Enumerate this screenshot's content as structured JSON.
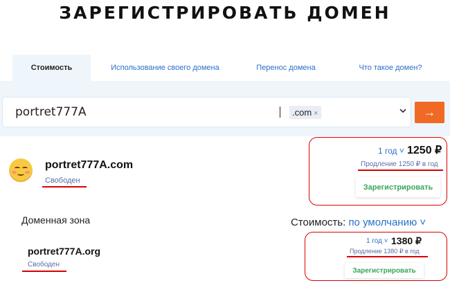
{
  "page": {
    "title": "ЗАРЕГИСТРИРОВАТЬ ДОМЕН"
  },
  "tabs": [
    {
      "label": "Стоимость",
      "active": true
    },
    {
      "label": "Использование своего домена",
      "active": false
    },
    {
      "label": "Перенос домена",
      "active": false
    },
    {
      "label": "Что такое домен?",
      "active": false
    }
  ],
  "search": {
    "value": "portret777A",
    "zone_chip": ".com",
    "chip_remove": "×",
    "dropdown_icon": "chevron-down-icon",
    "submit_icon": "arrow-right-icon",
    "submit_symbol": "→"
  },
  "results": [
    {
      "domain": "portret777A.com",
      "status": "Свободен",
      "period": "1 год ˅",
      "price": "1250 ₽",
      "renewal": "Продление 1250 ₽ в год",
      "register_label": "Зарегистрировать"
    },
    {
      "domain": "portret777A.org",
      "status": "Свободен",
      "period": "1 год ˅",
      "price": "1380 ₽",
      "renewal": "Продление 1380 ₽ в год",
      "register_label": "Зарегистрировать"
    }
  ],
  "zone_section": {
    "label": "Доменная зона",
    "cost_label": "Стоимость:",
    "cost_value": "по умолчанию ˅"
  },
  "colors": {
    "accent": "#f06a26",
    "link": "#2b6fc7",
    "register": "#3aa55a",
    "annotation": "#d90000",
    "search_band": "#eef6fb"
  }
}
